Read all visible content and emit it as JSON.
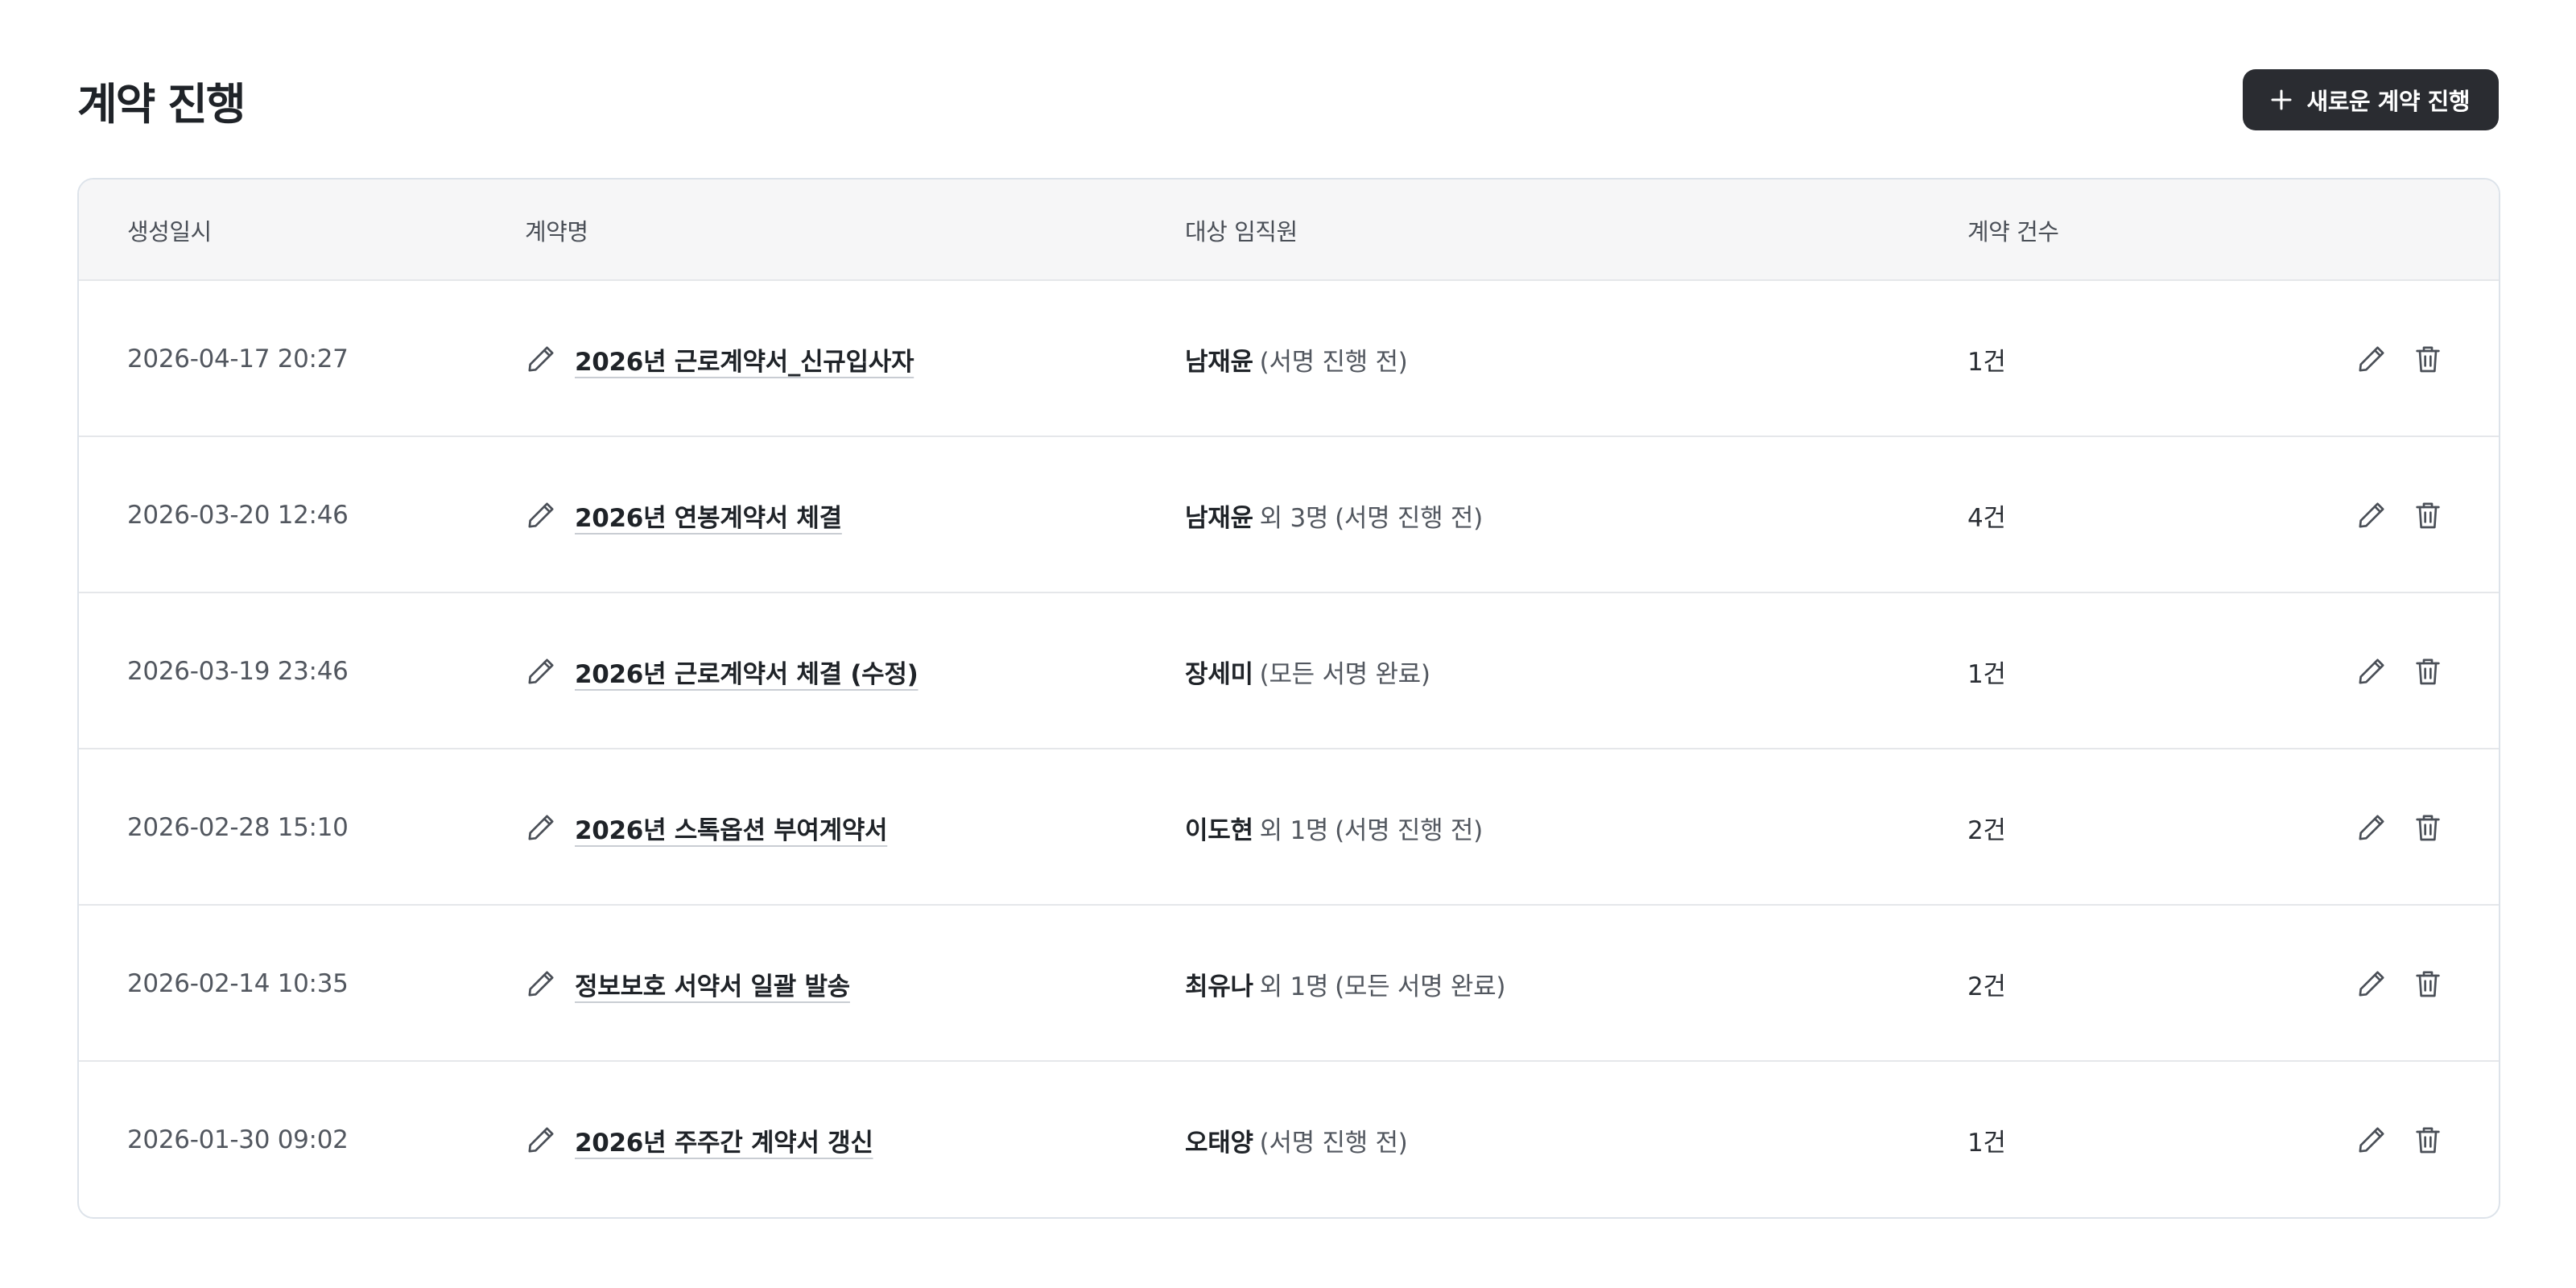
{
  "page": {
    "title": "계약 진행",
    "new_button_label": "새로운 계약 진행"
  },
  "table": {
    "headers": {
      "created_at": "생성일시",
      "contract_name": "계약명",
      "employees": "대상 임직원",
      "count": "계약 건수"
    },
    "rows": [
      {
        "created_at": "2026-04-17 20:27",
        "name": "2026년 근로계약서_신규입사자",
        "employee": "남재윤",
        "extra": "",
        "status": "(서명 진행 전)",
        "count": "1건"
      },
      {
        "created_at": "2026-03-20 12:46",
        "name": "2026년 연봉계약서 체결",
        "employee": "남재윤",
        "extra": "외 3명",
        "status": "(서명 진행 전)",
        "count": "4건"
      },
      {
        "created_at": "2026-03-19 23:46",
        "name": "2026년 근로계약서 체결 (수정)",
        "employee": "장세미",
        "extra": "",
        "status": "(모든 서명 완료)",
        "count": "1건"
      },
      {
        "created_at": "2026-02-28 15:10",
        "name": "2026년 스톡옵션 부여계약서",
        "employee": "이도현",
        "extra": "외 1명",
        "status": "(서명 진행 전)",
        "count": "2건"
      },
      {
        "created_at": "2026-02-14 10:35",
        "name": "정보보호 서약서 일괄 발송",
        "employee": "최유나",
        "extra": "외 1명",
        "status": "(모든 서명 완료)",
        "count": "2건"
      },
      {
        "created_at": "2026-01-30 09:02",
        "name": "2026년 주주간 계약서 갱신",
        "employee": "오태양",
        "extra": "",
        "status": "(서명 진행 전)",
        "count": "1건"
      }
    ]
  },
  "icons": {
    "plus": "plus-icon",
    "edit": "pencil-icon",
    "delete": "trash-icon"
  },
  "colors": {
    "primary_button": "#2a2c31",
    "header_background": "#f6f6f7",
    "border": "#dde3ea"
  }
}
